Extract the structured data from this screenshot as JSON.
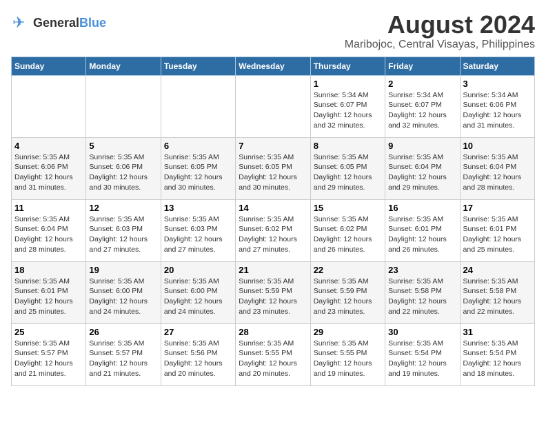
{
  "header": {
    "logo_line1": "General",
    "logo_line2": "Blue",
    "title": "August 2024",
    "subtitle": "Maribojoc, Central Visayas, Philippines"
  },
  "calendar": {
    "days_of_week": [
      "Sunday",
      "Monday",
      "Tuesday",
      "Wednesday",
      "Thursday",
      "Friday",
      "Saturday"
    ],
    "weeks": [
      [
        {
          "day": "",
          "info": ""
        },
        {
          "day": "",
          "info": ""
        },
        {
          "day": "",
          "info": ""
        },
        {
          "day": "",
          "info": ""
        },
        {
          "day": "1",
          "info": "Sunrise: 5:34 AM\nSunset: 6:07 PM\nDaylight: 12 hours\nand 32 minutes."
        },
        {
          "day": "2",
          "info": "Sunrise: 5:34 AM\nSunset: 6:07 PM\nDaylight: 12 hours\nand 32 minutes."
        },
        {
          "day": "3",
          "info": "Sunrise: 5:34 AM\nSunset: 6:06 PM\nDaylight: 12 hours\nand 31 minutes."
        }
      ],
      [
        {
          "day": "4",
          "info": "Sunrise: 5:35 AM\nSunset: 6:06 PM\nDaylight: 12 hours\nand 31 minutes."
        },
        {
          "day": "5",
          "info": "Sunrise: 5:35 AM\nSunset: 6:06 PM\nDaylight: 12 hours\nand 30 minutes."
        },
        {
          "day": "6",
          "info": "Sunrise: 5:35 AM\nSunset: 6:05 PM\nDaylight: 12 hours\nand 30 minutes."
        },
        {
          "day": "7",
          "info": "Sunrise: 5:35 AM\nSunset: 6:05 PM\nDaylight: 12 hours\nand 30 minutes."
        },
        {
          "day": "8",
          "info": "Sunrise: 5:35 AM\nSunset: 6:05 PM\nDaylight: 12 hours\nand 29 minutes."
        },
        {
          "day": "9",
          "info": "Sunrise: 5:35 AM\nSunset: 6:04 PM\nDaylight: 12 hours\nand 29 minutes."
        },
        {
          "day": "10",
          "info": "Sunrise: 5:35 AM\nSunset: 6:04 PM\nDaylight: 12 hours\nand 28 minutes."
        }
      ],
      [
        {
          "day": "11",
          "info": "Sunrise: 5:35 AM\nSunset: 6:04 PM\nDaylight: 12 hours\nand 28 minutes."
        },
        {
          "day": "12",
          "info": "Sunrise: 5:35 AM\nSunset: 6:03 PM\nDaylight: 12 hours\nand 27 minutes."
        },
        {
          "day": "13",
          "info": "Sunrise: 5:35 AM\nSunset: 6:03 PM\nDaylight: 12 hours\nand 27 minutes."
        },
        {
          "day": "14",
          "info": "Sunrise: 5:35 AM\nSunset: 6:02 PM\nDaylight: 12 hours\nand 27 minutes."
        },
        {
          "day": "15",
          "info": "Sunrise: 5:35 AM\nSunset: 6:02 PM\nDaylight: 12 hours\nand 26 minutes."
        },
        {
          "day": "16",
          "info": "Sunrise: 5:35 AM\nSunset: 6:01 PM\nDaylight: 12 hours\nand 26 minutes."
        },
        {
          "day": "17",
          "info": "Sunrise: 5:35 AM\nSunset: 6:01 PM\nDaylight: 12 hours\nand 25 minutes."
        }
      ],
      [
        {
          "day": "18",
          "info": "Sunrise: 5:35 AM\nSunset: 6:01 PM\nDaylight: 12 hours\nand 25 minutes."
        },
        {
          "day": "19",
          "info": "Sunrise: 5:35 AM\nSunset: 6:00 PM\nDaylight: 12 hours\nand 24 minutes."
        },
        {
          "day": "20",
          "info": "Sunrise: 5:35 AM\nSunset: 6:00 PM\nDaylight: 12 hours\nand 24 minutes."
        },
        {
          "day": "21",
          "info": "Sunrise: 5:35 AM\nSunset: 5:59 PM\nDaylight: 12 hours\nand 23 minutes."
        },
        {
          "day": "22",
          "info": "Sunrise: 5:35 AM\nSunset: 5:59 PM\nDaylight: 12 hours\nand 23 minutes."
        },
        {
          "day": "23",
          "info": "Sunrise: 5:35 AM\nSunset: 5:58 PM\nDaylight: 12 hours\nand 22 minutes."
        },
        {
          "day": "24",
          "info": "Sunrise: 5:35 AM\nSunset: 5:58 PM\nDaylight: 12 hours\nand 22 minutes."
        }
      ],
      [
        {
          "day": "25",
          "info": "Sunrise: 5:35 AM\nSunset: 5:57 PM\nDaylight: 12 hours\nand 21 minutes."
        },
        {
          "day": "26",
          "info": "Sunrise: 5:35 AM\nSunset: 5:57 PM\nDaylight: 12 hours\nand 21 minutes."
        },
        {
          "day": "27",
          "info": "Sunrise: 5:35 AM\nSunset: 5:56 PM\nDaylight: 12 hours\nand 20 minutes."
        },
        {
          "day": "28",
          "info": "Sunrise: 5:35 AM\nSunset: 5:55 PM\nDaylight: 12 hours\nand 20 minutes."
        },
        {
          "day": "29",
          "info": "Sunrise: 5:35 AM\nSunset: 5:55 PM\nDaylight: 12 hours\nand 19 minutes."
        },
        {
          "day": "30",
          "info": "Sunrise: 5:35 AM\nSunset: 5:54 PM\nDaylight: 12 hours\nand 19 minutes."
        },
        {
          "day": "31",
          "info": "Sunrise: 5:35 AM\nSunset: 5:54 PM\nDaylight: 12 hours\nand 18 minutes."
        }
      ]
    ]
  }
}
